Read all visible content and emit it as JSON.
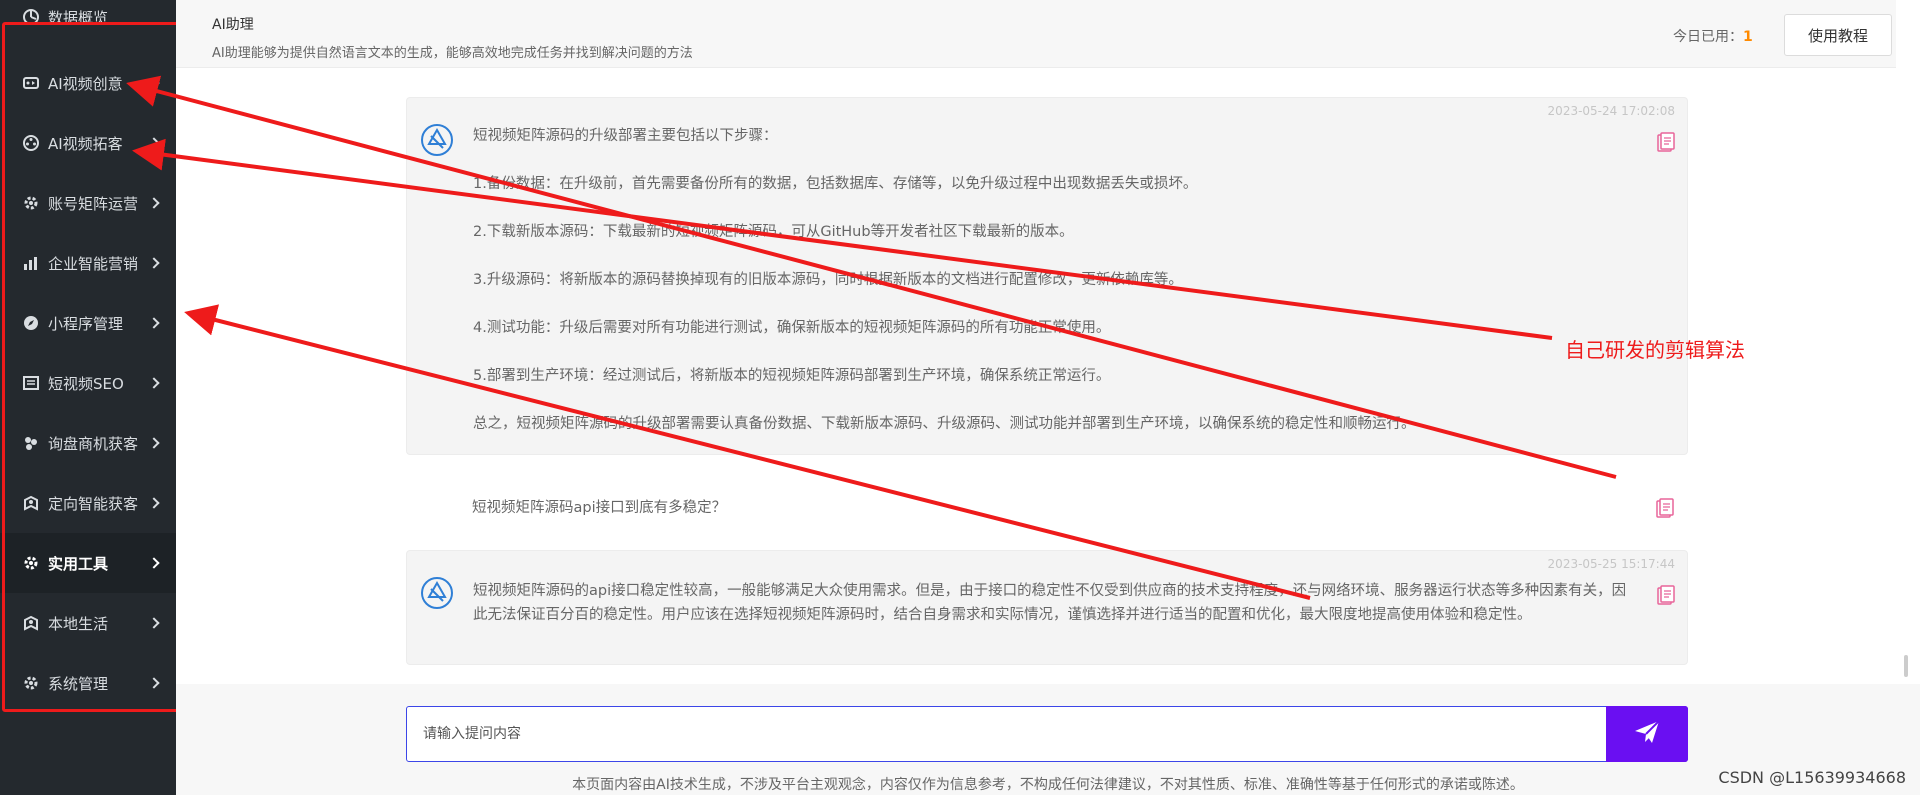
{
  "sidebar": {
    "top_item": {
      "label": "数据概览",
      "icon": "chart-icon"
    },
    "items": [
      {
        "label": "AI视频创意",
        "icon": "video-icon"
      },
      {
        "label": "AI视频拓客",
        "icon": "film-reel-icon"
      },
      {
        "label": "账号矩阵运营",
        "icon": "gear-icon"
      },
      {
        "label": "企业智能营销",
        "icon": "bar-chart-icon"
      },
      {
        "label": "小程序管理",
        "icon": "compass-icon"
      },
      {
        "label": "短视频SEO",
        "icon": "list-icon"
      },
      {
        "label": "询盘商机获客",
        "icon": "users-icon"
      },
      {
        "label": "定向智能获客",
        "icon": "map-pin-icon"
      },
      {
        "label": "实用工具",
        "icon": "gear-icon",
        "active": true
      },
      {
        "label": "本地生活",
        "icon": "map-pin-icon"
      },
      {
        "label": "系统管理",
        "icon": "gear-icon"
      }
    ]
  },
  "header": {
    "title": "AI助理",
    "description": "AI助理能够为提供自然语言文本的生成，能够高效地完成任务并找到解决问题的方法",
    "usage_label": "今日已用：",
    "usage_count": "1",
    "tutorial_button": "使用教程"
  },
  "messages": [
    {
      "role": "assistant",
      "timestamp": "2023-05-24 17:02:08",
      "paragraphs": [
        "短视频矩阵源码的升级部署主要包括以下步骤：",
        "1.备份数据：在升级前，首先需要备份所有的数据，包括数据库、存储等，以免升级过程中出现数据丢失或损坏。",
        "2.下载新版本源码：下载最新的短视频矩阵源码，可从GitHub等开发者社区下载最新的版本。",
        "3.升级源码：将新版本的源码替换掉现有的旧版本源码，同时根据新版本的文档进行配置修改，更新依赖库等。",
        "4.测试功能：升级后需要对所有功能进行测试，确保新版本的短视频矩阵源码的所有功能正常使用。",
        "5.部署到生产环境：经过测试后，将新版本的短视频矩阵源码部署到生产环境，确保系统正常运行。",
        "总之，短视频矩阵源码的升级部署需要认真备份数据、下载新版本源码、升级源码、测试功能并部署到生产环境，以确保系统的稳定性和顺畅运行。"
      ]
    },
    {
      "role": "user",
      "text": "短视频矩阵源码api接口到底有多稳定？"
    },
    {
      "role": "assistant",
      "timestamp": "2023-05-25 15:17:44",
      "paragraphs": [
        "短视频矩阵源码的api接口稳定性较高，一般能够满足大众使用需求。但是，由于接口的稳定性不仅受到供应商的技术支持程度，还与网络环境、服务器运行状态等多种因素有关，因此无法保证百分百的稳定性。用户应该在选择短视频矩阵源码时，结合自身需求和实际情况，谨慎选择并进行适当的配置和优化，最大限度地提高使用体验和稳定性。"
      ]
    }
  ],
  "input": {
    "placeholder": "请输入提问内容",
    "send_icon": "paper-plane-icon"
  },
  "disclaimer": "本页面内容由AI技术生成，不涉及平台主观观念，内容仅作为信息参考，不构成任何法律建议，不对其性质、标准、准确性等基于任何形式的承诺或陈述。",
  "annotation": {
    "label": "自己研发的剪辑算法",
    "color": "#ee1b1b"
  },
  "watermark": "CSDN @L15639934668",
  "colors": {
    "sidebar_bg": "#24292e",
    "accent_purple": "#6a0ff2",
    "usage_orange": "#ff8a00",
    "copy_icon_pink": "#e8659a",
    "avatar_blue": "#2f7fd6"
  }
}
